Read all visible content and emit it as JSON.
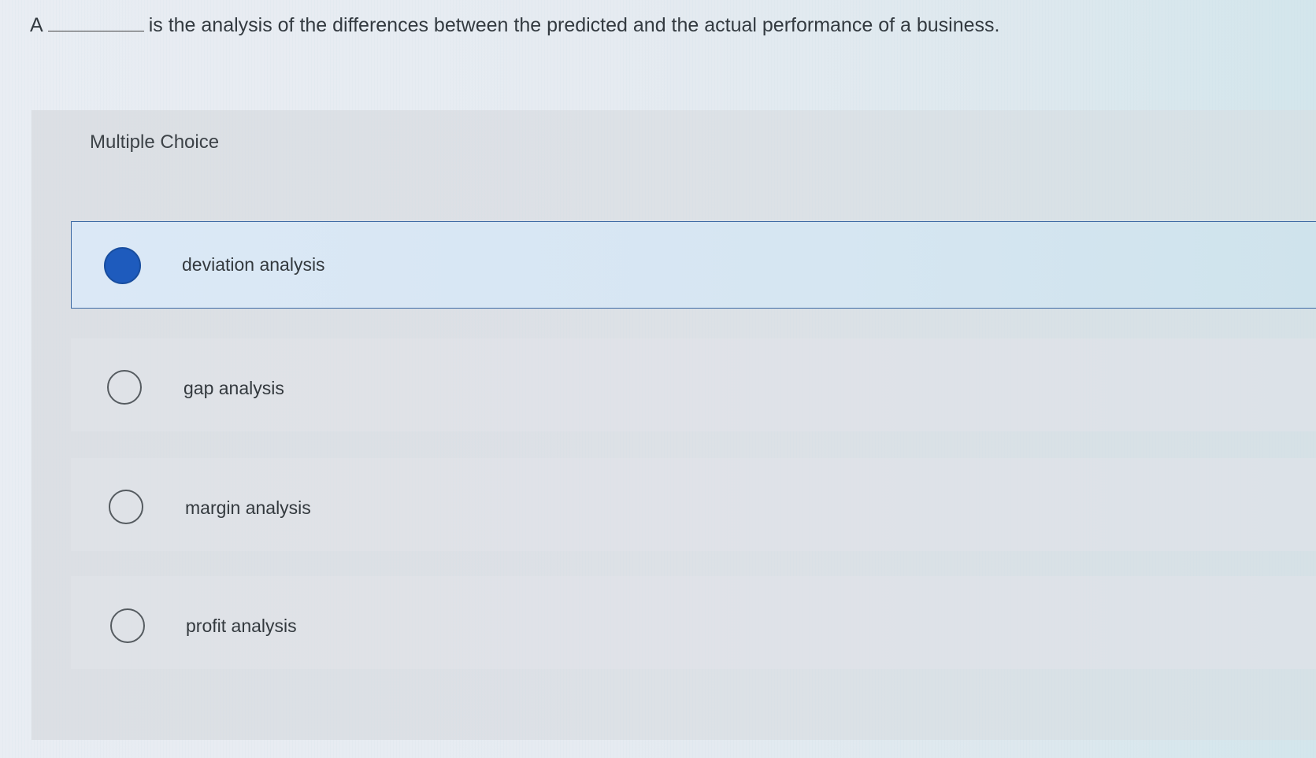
{
  "question": {
    "prefix": "A",
    "suffix": "is the analysis of the differences between the predicted and the actual performance of a business."
  },
  "section_label": "Multiple Choice",
  "options": [
    {
      "label": "deviation analysis",
      "selected": true
    },
    {
      "label": "gap analysis",
      "selected": false
    },
    {
      "label": "margin analysis",
      "selected": false
    },
    {
      "label": "profit analysis",
      "selected": false
    }
  ],
  "colors": {
    "selected_radio": "#1e5bbd",
    "selected_border": "#3d6aa4"
  }
}
